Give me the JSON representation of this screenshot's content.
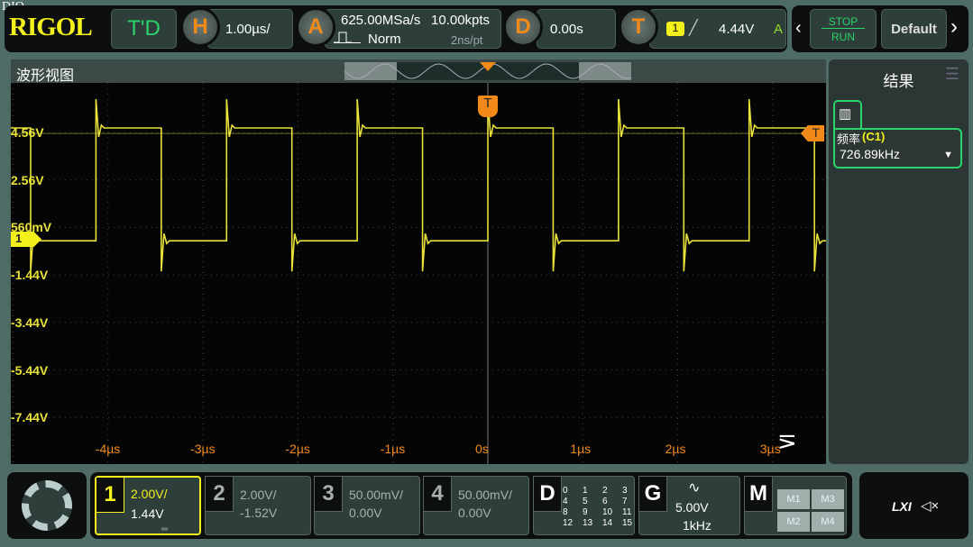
{
  "top": {
    "dio": "DIO",
    "logo": "RIGOL",
    "mode": "T'D",
    "h_label": "H",
    "timebase": "1.00µs/",
    "a_label": "A",
    "sample_rate": "625.00MSa/s",
    "mem_depth": "10.00kpts",
    "acq_mode": "Norm",
    "sample_interval": "2ns/pt",
    "d_label": "D",
    "delay": "0.00s",
    "t_label": "T",
    "trig_source": "1",
    "trig_level": "4.44V",
    "trig_sweep": "A",
    "stop": "STOP",
    "run": "RUN",
    "default": "Default"
  },
  "view": {
    "title": "波形视图",
    "trigger_marker": "T",
    "channel_marker": "1",
    "volt_labels": [
      "4.56V",
      "2.56V",
      "560mV",
      "-1.44V",
      "-3.44V",
      "-5.44V",
      "-7.44V"
    ],
    "time_labels": [
      "-4µs",
      "-3µs",
      "-2µs",
      "-1µs",
      "0s",
      "1µs",
      "2µs",
      "3µs",
      "4µs"
    ]
  },
  "signal": {
    "frequency_khz": 726.89,
    "high_v": 4.75,
    "low_v": 0.0,
    "duty": 0.5,
    "color": "#e8e23a"
  },
  "result": {
    "title": "结果",
    "meas_label": "频率",
    "meas_src": "(C1)",
    "meas_value": "726.89kHz"
  },
  "channels": [
    {
      "num": "1",
      "scale": "2.00V/",
      "offset": "1.44V"
    },
    {
      "num": "2",
      "scale": "2.00V/",
      "offset": "-1.52V"
    },
    {
      "num": "3",
      "scale": "50.00mV/",
      "offset": "0.00V"
    },
    {
      "num": "4",
      "scale": "50.00mV/",
      "offset": "0.00V"
    }
  ],
  "digital": {
    "label": "D",
    "bits": [
      "0",
      "1",
      "2",
      "3",
      "4",
      "5",
      "6",
      "7",
      "8",
      "9",
      "10",
      "11",
      "12",
      "13",
      "14",
      "15"
    ]
  },
  "gen": {
    "label": "G",
    "amp": "5.00V",
    "freq": "1kHz"
  },
  "math": {
    "label": "M",
    "items": [
      "M1",
      "M3",
      "M2",
      "M4"
    ]
  },
  "status": {
    "lxi": "LXI"
  }
}
